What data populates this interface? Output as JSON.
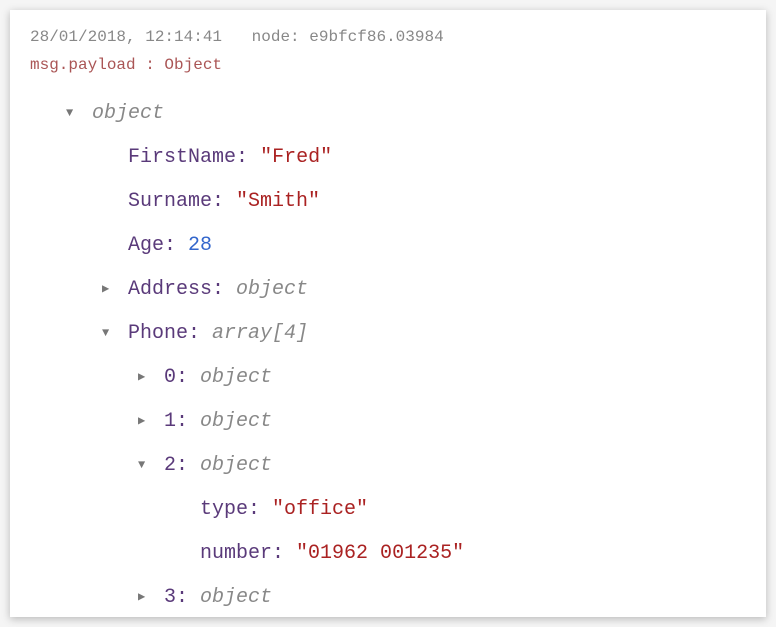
{
  "header": {
    "timestamp": "28/01/2018, 12:14:41",
    "node_label": "node:",
    "node_id": "e9bfcf86.03984"
  },
  "path_label": "msg.payload : Object",
  "tree": {
    "root_type": "object",
    "FirstName": {
      "key": "FirstName",
      "value": "\"Fred\""
    },
    "Surname": {
      "key": "Surname",
      "value": "\"Smith\""
    },
    "Age": {
      "key": "Age",
      "value": "28"
    },
    "Address": {
      "key": "Address",
      "type": "object"
    },
    "Phone": {
      "key": "Phone",
      "type": "array[4]",
      "items": {
        "i0": {
          "key": "0",
          "type": "object"
        },
        "i1": {
          "key": "1",
          "type": "object"
        },
        "i2": {
          "key": "2",
          "type": "object",
          "type_field": {
            "key": "type",
            "value": "\"office\""
          },
          "number_field": {
            "key": "number",
            "value": "\"01962 001235\""
          }
        },
        "i3": {
          "key": "3",
          "type": "object"
        }
      }
    }
  }
}
